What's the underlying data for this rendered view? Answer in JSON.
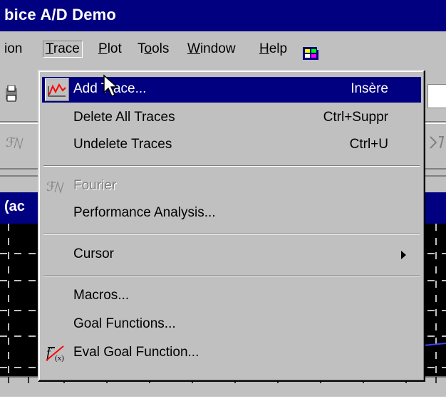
{
  "window": {
    "title": "bice A/D Demo"
  },
  "menubar": {
    "items": [
      {
        "label": "ion",
        "underline": ""
      },
      {
        "label": "Trace",
        "underline": "T"
      },
      {
        "label": "Plot",
        "underline": "P"
      },
      {
        "label": "Tools",
        "underline": "o"
      },
      {
        "label": "Window",
        "underline": "W"
      },
      {
        "label": "Help",
        "underline": "H"
      }
    ]
  },
  "plot": {
    "title": "(ac"
  },
  "menu": {
    "items": [
      {
        "label": "Add Trace...",
        "shortcut": "Insère",
        "icon": "add-trace-icon",
        "highlighted": true
      },
      {
        "label": "Delete All Traces",
        "shortcut": "Ctrl+Suppr"
      },
      {
        "label": "Undelete Traces",
        "shortcut": "Ctrl+U"
      },
      {
        "label": "Fourier",
        "icon": "fourier-icon",
        "disabled": true
      },
      {
        "label": "Performance Analysis..."
      },
      {
        "label": "Cursor",
        "submenu": true
      },
      {
        "label": "Macros..."
      },
      {
        "label": "Goal Functions..."
      },
      {
        "label": "Eval Goal Function...",
        "icon": "eval-goal-icon"
      }
    ]
  },
  "colors": {
    "highlight": "#000080",
    "menu_bg": "#c0c0c0",
    "plot_bg": "#000000",
    "trace": "#4040ff"
  }
}
